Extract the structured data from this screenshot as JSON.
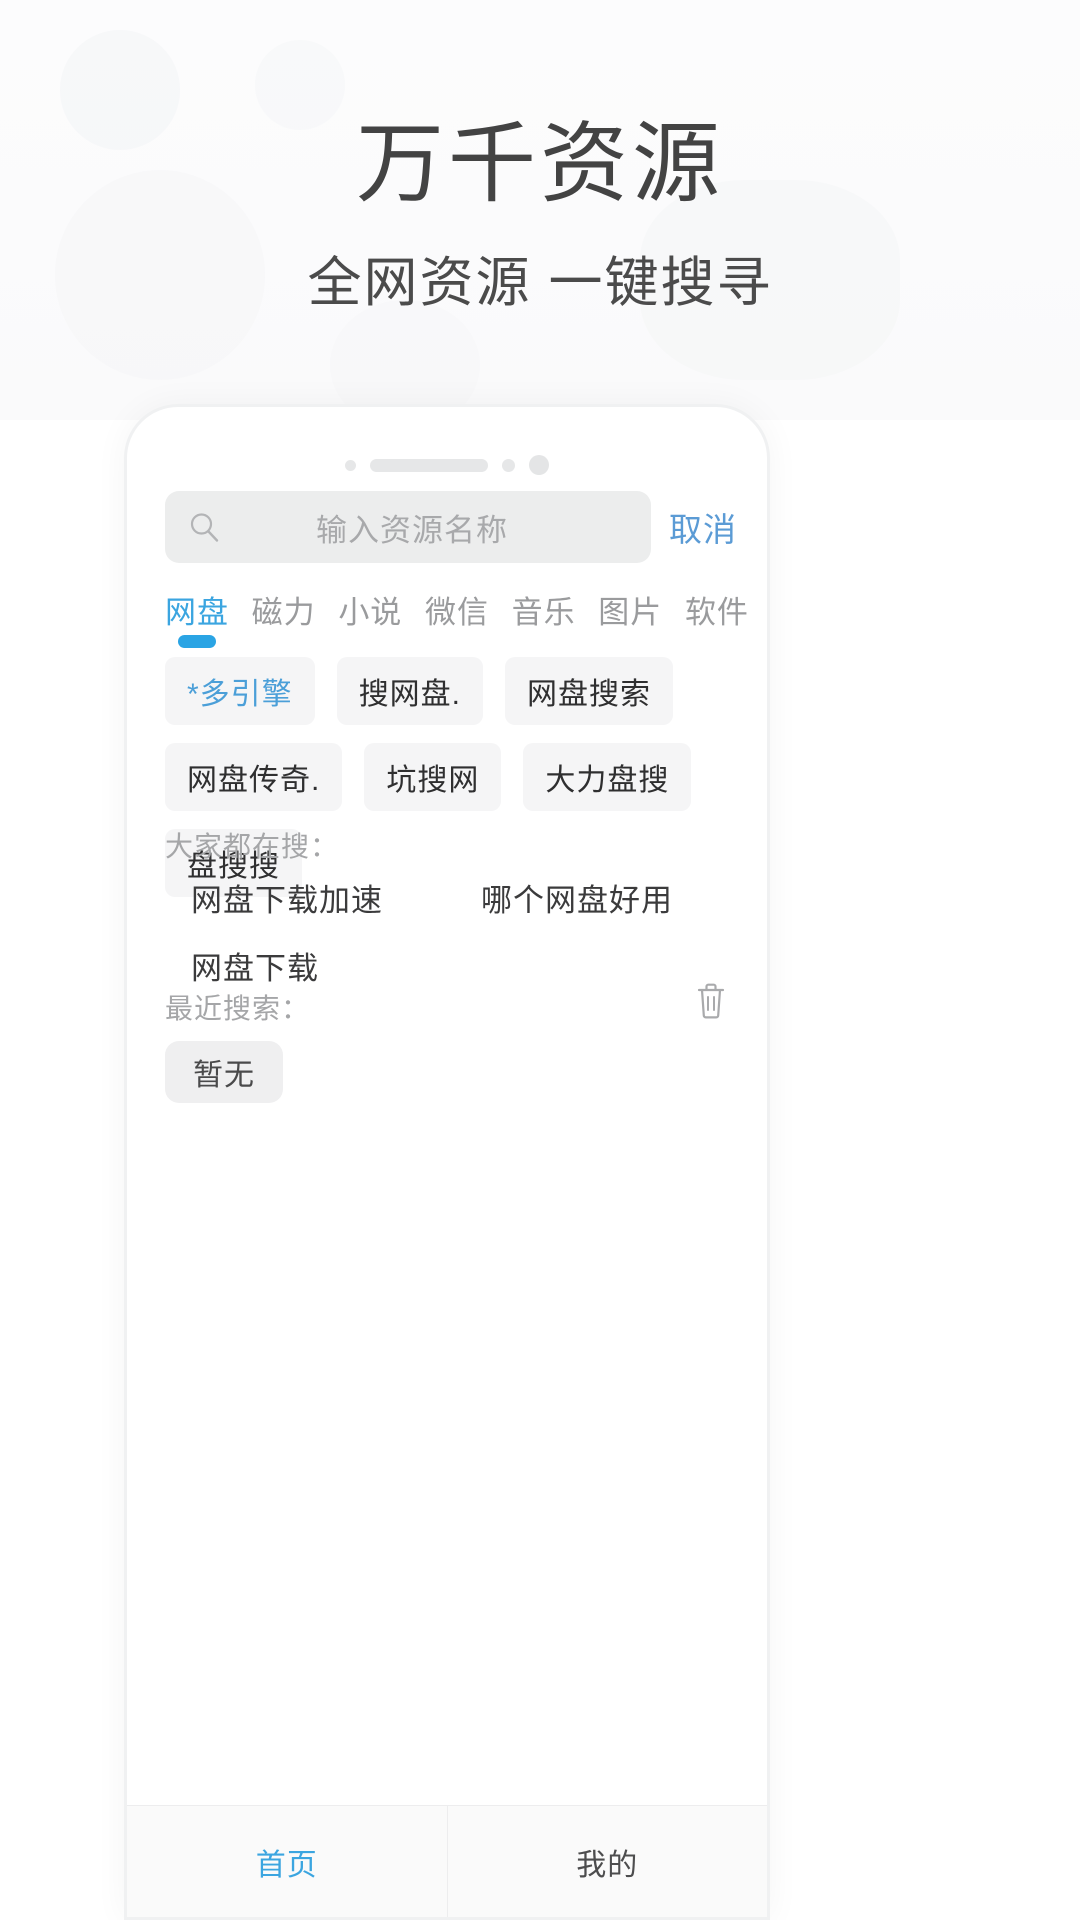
{
  "promo": {
    "title": "万千资源",
    "subtitle": "全网资源 一键搜寻"
  },
  "search": {
    "placeholder": "输入资源名称",
    "value": "",
    "icon": "search-icon",
    "cancel_label": "取消"
  },
  "tabs": [
    {
      "label": "网盘",
      "active": true
    },
    {
      "label": "磁力",
      "active": false
    },
    {
      "label": "小说",
      "active": false
    },
    {
      "label": "微信",
      "active": false
    },
    {
      "label": "音乐",
      "active": false
    },
    {
      "label": "图片",
      "active": false
    },
    {
      "label": "软件",
      "active": false
    }
  ],
  "engines": [
    {
      "label": "*多引擎",
      "selected": true
    },
    {
      "label": "搜网盘.",
      "selected": false
    },
    {
      "label": "网盘搜索",
      "selected": false
    },
    {
      "label": "网盘传奇.",
      "selected": false
    },
    {
      "label": "坑搜网",
      "selected": false
    },
    {
      "label": "大力盘搜",
      "selected": false
    },
    {
      "label": "盘搜搜",
      "selected": false
    }
  ],
  "hot": {
    "label": "大家都在搜：",
    "items": [
      "网盘下载加速",
      "哪个网盘好用",
      "网盘下载"
    ]
  },
  "recent": {
    "label": "最近搜索：",
    "clear_icon": "trash-icon",
    "items": [
      "暂无"
    ]
  },
  "bottom_nav": [
    {
      "label": "首页",
      "active": true
    },
    {
      "label": "我的",
      "active": false
    }
  ],
  "colors": {
    "accent": "#3ba5e0",
    "tab_underline": "#2aa4e4",
    "chip_bg": "#f5f5f6",
    "search_bg": "#eceded",
    "title_text": "#434343",
    "muted_text": "#a5a6a8"
  }
}
